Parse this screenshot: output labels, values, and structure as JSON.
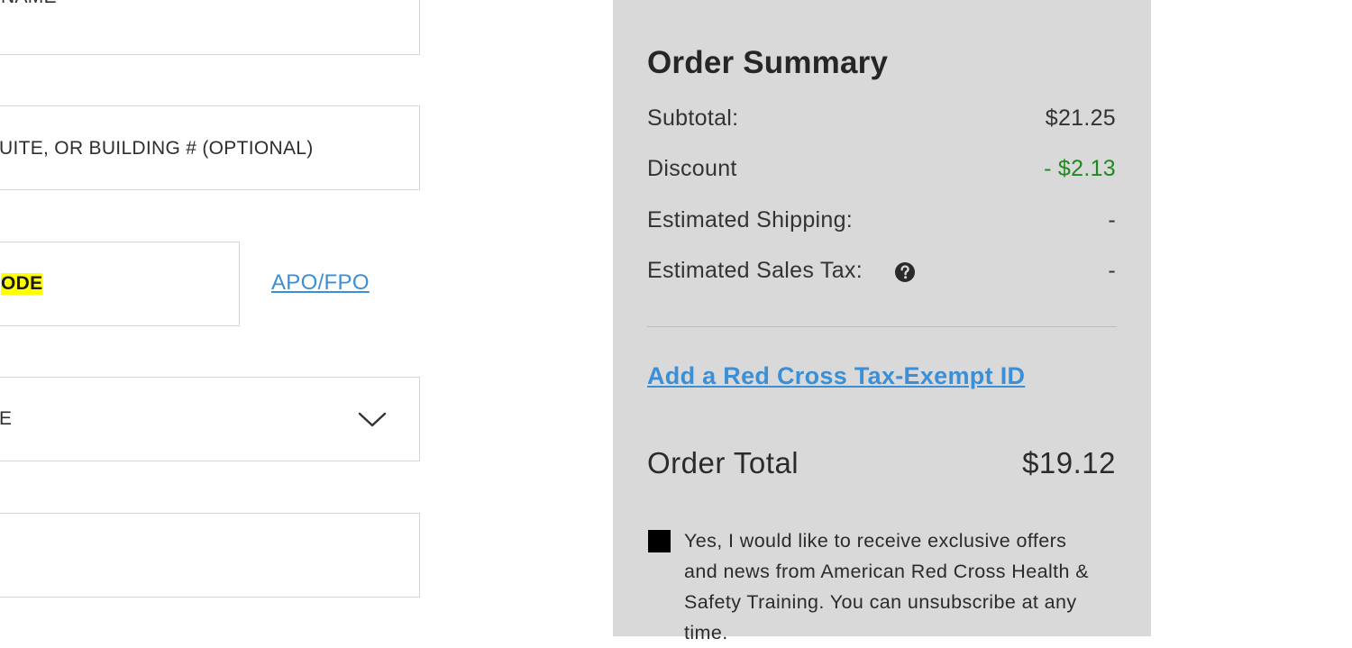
{
  "form": {
    "name_field": {
      "placeholder": "NAME"
    },
    "address2_field": {
      "placeholder": "UITE, OR BUILDING # (OPTIONAL)"
    },
    "zip_field": {
      "placeholder": "ODE"
    },
    "apo_link": "APO/FPO",
    "state_select": {
      "visible_text": "E"
    },
    "phone_field": {
      "placeholder": ""
    }
  },
  "summary": {
    "title": "Order Summary",
    "subtotal": {
      "label": "Subtotal:",
      "value": "$21.25"
    },
    "discount": {
      "label": "Discount",
      "value": "- $2.13"
    },
    "shipping": {
      "label": "Estimated Shipping:",
      "value": "-"
    },
    "tax": {
      "label": "Estimated Sales Tax:",
      "value": "-",
      "icon": "question-circle-icon"
    },
    "tax_exempt_link": "Add a Red Cross Tax-Exempt ID",
    "total": {
      "label": "Order Total",
      "value": "$19.12"
    },
    "optin_text": "Yes, I would like to receive exclusive offers and news from American Red Cross Health & Safety Training. You can unsubscribe at any time."
  },
  "colors": {
    "link": "#3a8fd6",
    "discount": "#1e8a1e",
    "panel_background": "#d9d9d9",
    "highlight": "#ffff00"
  }
}
